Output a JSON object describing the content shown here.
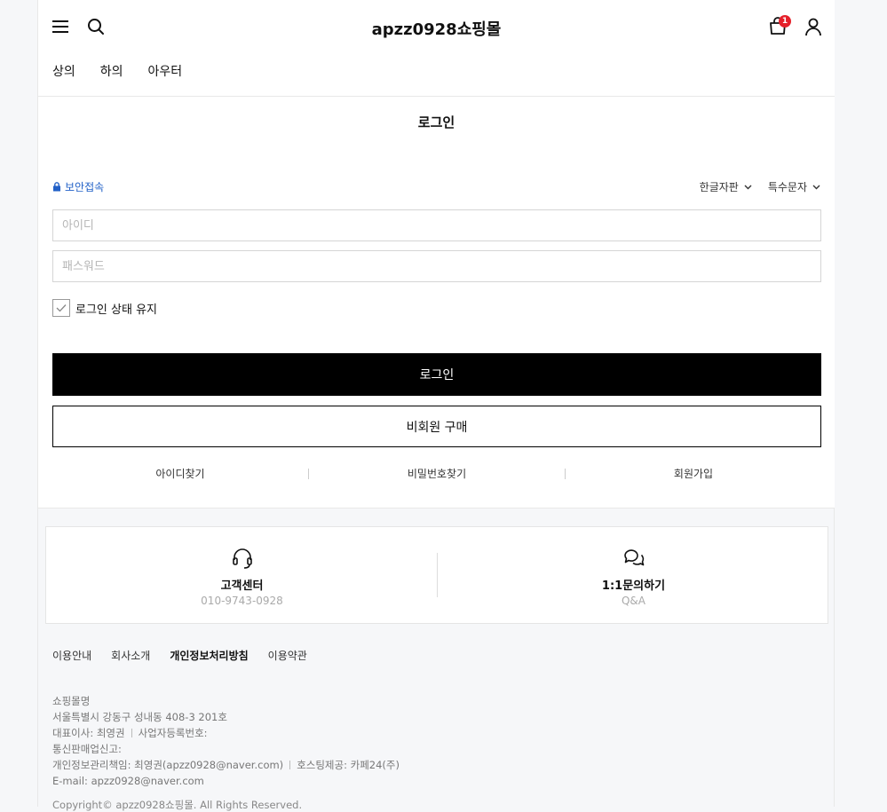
{
  "header": {
    "logo": "apzz0928쇼핑몰",
    "cart_count": "1",
    "nav": [
      "상의",
      "하의",
      "아우터"
    ]
  },
  "login": {
    "title": "로그인",
    "secure_label": "보안접속",
    "keyboard_korean": "한글자판",
    "keyboard_special": "특수문자",
    "id_placeholder": "아이디",
    "pw_placeholder": "패스워드",
    "keep_label": "로그인 상태 유지",
    "keep_checked": true,
    "login_button": "로그인",
    "guest_button": "비회원 구매",
    "find_id": "아이디찾기",
    "find_pw": "비밀번호찾기",
    "join": "회원가입"
  },
  "cs": {
    "center_title": "고객센터",
    "center_phone": "010-9743-0928",
    "inquiry_title": "1:1문의하기",
    "inquiry_sub": "Q&A"
  },
  "footer": {
    "links": [
      "이용안내",
      "회사소개",
      "개인정보처리방침",
      "이용약관"
    ],
    "shop_name": "쇼핑몰명",
    "address": "서울특별시 강동구 성내동 408-3 201호",
    "ceo": "대표이사: 최영권",
    "biz_no": "사업자등록번호:",
    "mail_order": "통신판매업신고:",
    "privacy_officer": "개인정보관리책임: 최영권(apzz0928@naver.com)",
    "hosting": "호스팅제공: 카페24(주)",
    "email": "E-mail: apzz0928@naver.com",
    "copyright": "Copyright© apzz0928쇼핑몰. All Rights Reserved."
  },
  "colors": {
    "accent_link": "#2160c7",
    "badge": "#e5202a",
    "primary_button": "#000000"
  }
}
